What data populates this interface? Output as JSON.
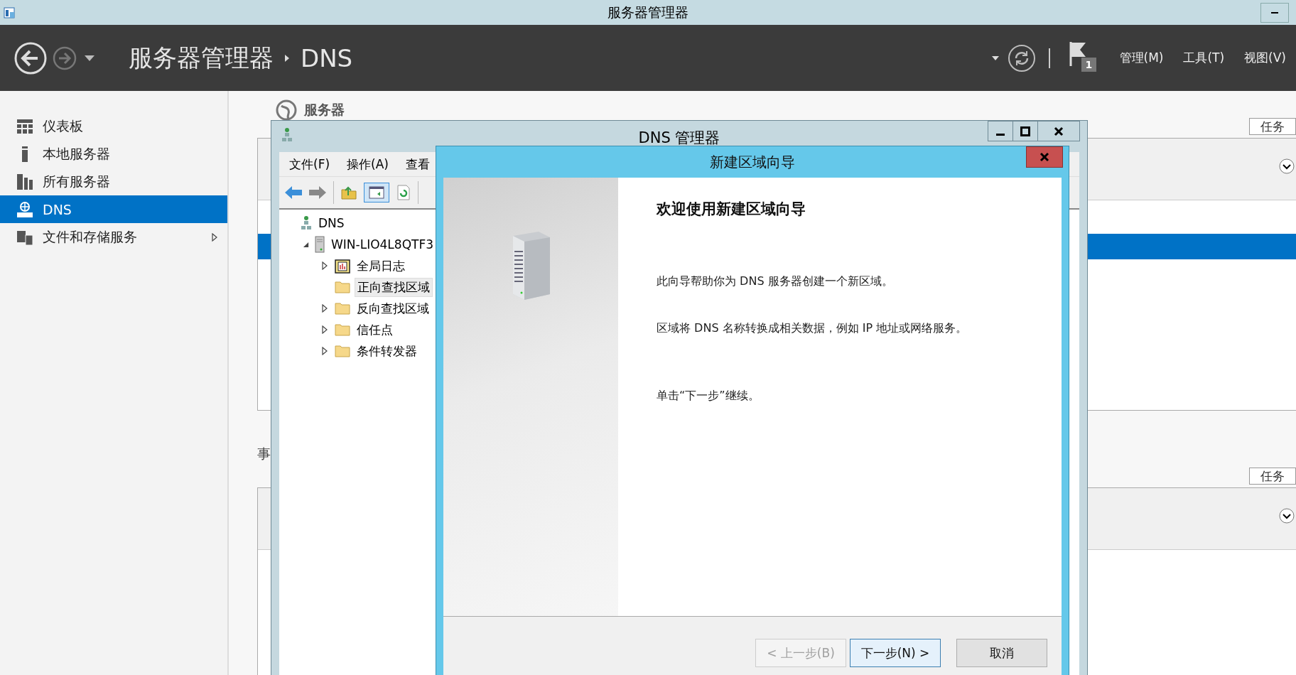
{
  "window": {
    "title": "服务器管理器"
  },
  "header": {
    "breadcrumb": [
      "服务器管理器",
      "DNS"
    ],
    "notification_count": "1",
    "menus": [
      "管理(M)",
      "工具(T)",
      "视图(V)"
    ]
  },
  "sidebar": {
    "items": [
      {
        "label": "仪表板",
        "kind": "dashboard",
        "selected": false,
        "expandable": false
      },
      {
        "label": "本地服务器",
        "kind": "local",
        "selected": false,
        "expandable": false
      },
      {
        "label": "所有服务器",
        "kind": "all",
        "selected": false,
        "expandable": false
      },
      {
        "label": "DNS",
        "kind": "dns",
        "selected": true,
        "expandable": false
      },
      {
        "label": "文件和存储服务",
        "kind": "files",
        "selected": false,
        "expandable": true
      }
    ]
  },
  "servers_section": {
    "title": "服务器",
    "tasks": "任务"
  },
  "events_section": {
    "title": "事",
    "tasks": "任务"
  },
  "dns_manager": {
    "title": "DNS 管理器",
    "menus": [
      "文件(F)",
      "操作(A)",
      "查看"
    ],
    "tree": [
      {
        "label": "DNS",
        "kind": "root",
        "expandable": false,
        "selected": false,
        "children": [
          {
            "label": "WIN-LIO4L8QTF3",
            "kind": "server",
            "expandable": true,
            "expanded": true,
            "selected": false,
            "children": [
              {
                "label": "全局日志",
                "kind": "log",
                "expandable": true,
                "expanded": false,
                "selected": false
              },
              {
                "label": "正向查找区域",
                "kind": "folder",
                "expandable": false,
                "selected": true
              },
              {
                "label": "反向查找区域",
                "kind": "folder",
                "expandable": true,
                "expanded": false,
                "selected": false
              },
              {
                "label": "信任点",
                "kind": "folder",
                "expandable": true,
                "expanded": false,
                "selected": false
              },
              {
                "label": "条件转发器",
                "kind": "folder",
                "expandable": true,
                "expanded": false,
                "selected": false
              }
            ]
          }
        ]
      }
    ]
  },
  "wizard": {
    "title": "新建区域向导",
    "heading": "欢迎使用新建区域向导",
    "paragraphs": [
      "此向导帮助你为 DNS 服务器创建一个新区域。",
      "区域将 DNS 名称转换成相关数据，例如 IP 地址或网络服务。",
      "单击“下一步”继续。"
    ],
    "buttons": [
      {
        "label": "< 上一步(B)",
        "disabled": true,
        "default": false
      },
      {
        "label": "下一步(N) >",
        "disabled": false,
        "default": true
      },
      {
        "label": "取消",
        "disabled": false,
        "default": false
      }
    ]
  }
}
